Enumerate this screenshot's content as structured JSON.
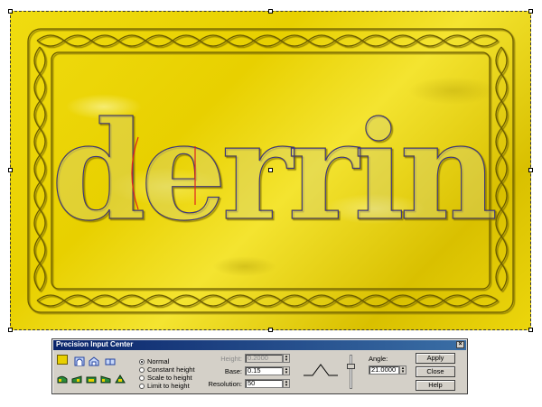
{
  "canvas": {
    "artwork_text": "derrin",
    "material_color": "#e8d000"
  },
  "dialog": {
    "title": "Precision Input Center",
    "close_symbol": "×",
    "tools_row1": [
      "square-swatch-icon",
      "arch-icon",
      "house-icon",
      "double-rect-icon"
    ],
    "tools_row2": [
      "ramp-icon-1",
      "ramp-icon-2",
      "ramp-icon-3",
      "ramp-icon-4",
      "ramp-icon-5"
    ],
    "modes": [
      {
        "label": "Normal",
        "selected": true
      },
      {
        "label": "Constant height",
        "selected": false
      },
      {
        "label": "Scale to height",
        "selected": false
      },
      {
        "label": "Limit to height",
        "selected": false
      }
    ],
    "height_label": "Height:",
    "height_value": "0.2000",
    "base_label": "Base:",
    "base_value": "0.15",
    "resolution_label": "Resolution:",
    "resolution_value": "50",
    "angle_label": "Angle:",
    "angle_value": "21.0000",
    "apply_label": "Apply",
    "close_label": "Close",
    "help_label": "Help",
    "spin_up": "▲",
    "spin_down": "▼",
    "swatch_color": "#e8d000"
  }
}
